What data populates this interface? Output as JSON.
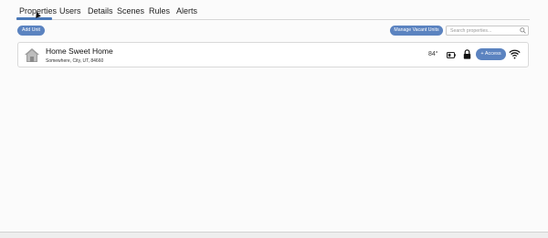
{
  "tabs": [
    {
      "label": "Properties",
      "active": true
    },
    {
      "label": "Users",
      "active": false
    },
    {
      "label": "Details",
      "active": false
    },
    {
      "label": "Scenes",
      "active": false
    },
    {
      "label": "Rules",
      "active": false
    },
    {
      "label": "Alerts",
      "active": false
    }
  ],
  "toolbar": {
    "add_unit_label": "Add Unit",
    "manage_vacant_label": "Manage Vacant Units",
    "search_placeholder": "Search properties..."
  },
  "units": [
    {
      "name": "Home Sweet Home",
      "address": "Somewhere, City, UT, 84660",
      "temperature": "84°",
      "access_label": "+ Access"
    }
  ],
  "colors": {
    "accent": "#5b83c0",
    "tab_underline": "#4a78b8",
    "background": "#fbfbfb"
  },
  "icons": [
    "search-icon",
    "house-icon",
    "battery-icon",
    "lock-icon",
    "wifi-icon",
    "cursor-icon"
  ]
}
